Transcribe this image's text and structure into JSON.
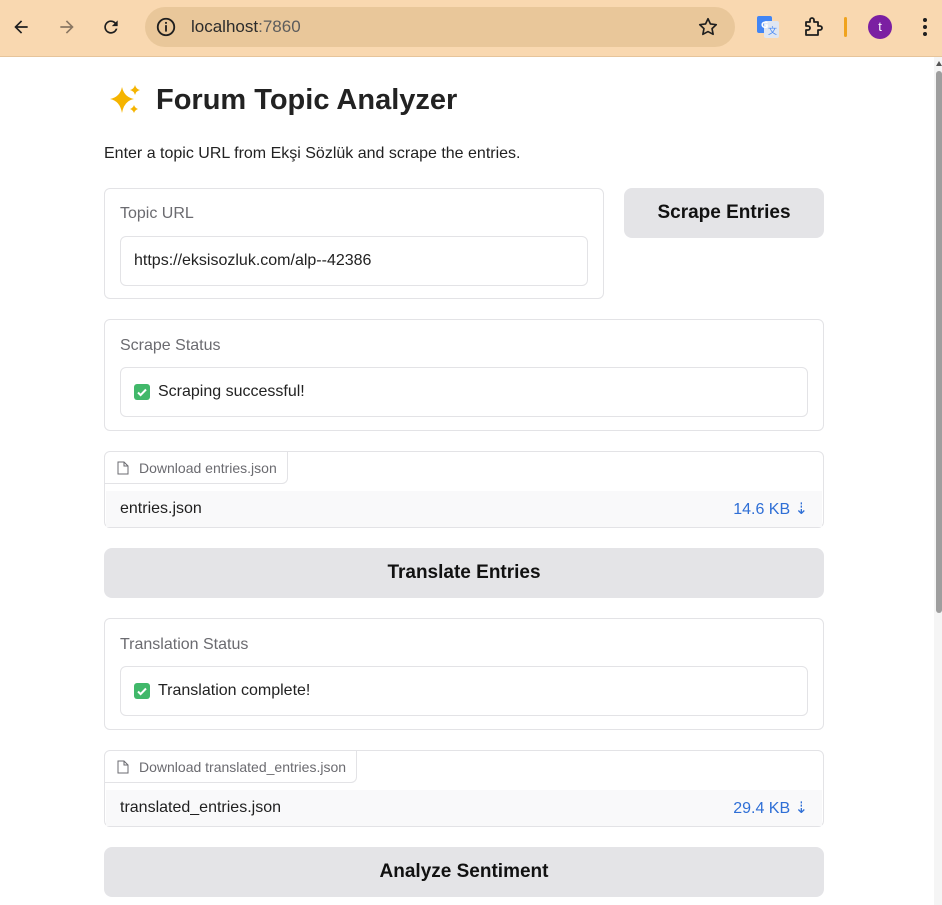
{
  "browser": {
    "url_host": "localhost",
    "url_port": ":7860",
    "avatar_letter": "t"
  },
  "app": {
    "title": "Forum Topic Analyzer",
    "subtitle": "Enter a topic URL from Ekşi Sözlük and scrape the entries."
  },
  "topic_url": {
    "label": "Topic URL",
    "value": "https://eksisozluk.com/alp--42386"
  },
  "scrape_button": "Scrape Entries",
  "scrape_status": {
    "label": "Scrape Status",
    "value": "Scraping successful!"
  },
  "download_entries": {
    "tag": "Download entries.json",
    "filename": "entries.json",
    "size": "14.6 KB ⇣"
  },
  "translate_button": "Translate Entries",
  "translation_status": {
    "label": "Translation Status",
    "value": "Translation complete!"
  },
  "download_translated": {
    "tag": "Download translated_entries.json",
    "filename": "translated_entries.json",
    "size": "29.4 KB ⇣"
  },
  "analyze_button": "Analyze Sentiment",
  "colors": {
    "chrome_bg": "#f9d8b0",
    "button_bg": "#e4e4e7",
    "success": "#41b86a",
    "link": "#2f6fd6"
  }
}
